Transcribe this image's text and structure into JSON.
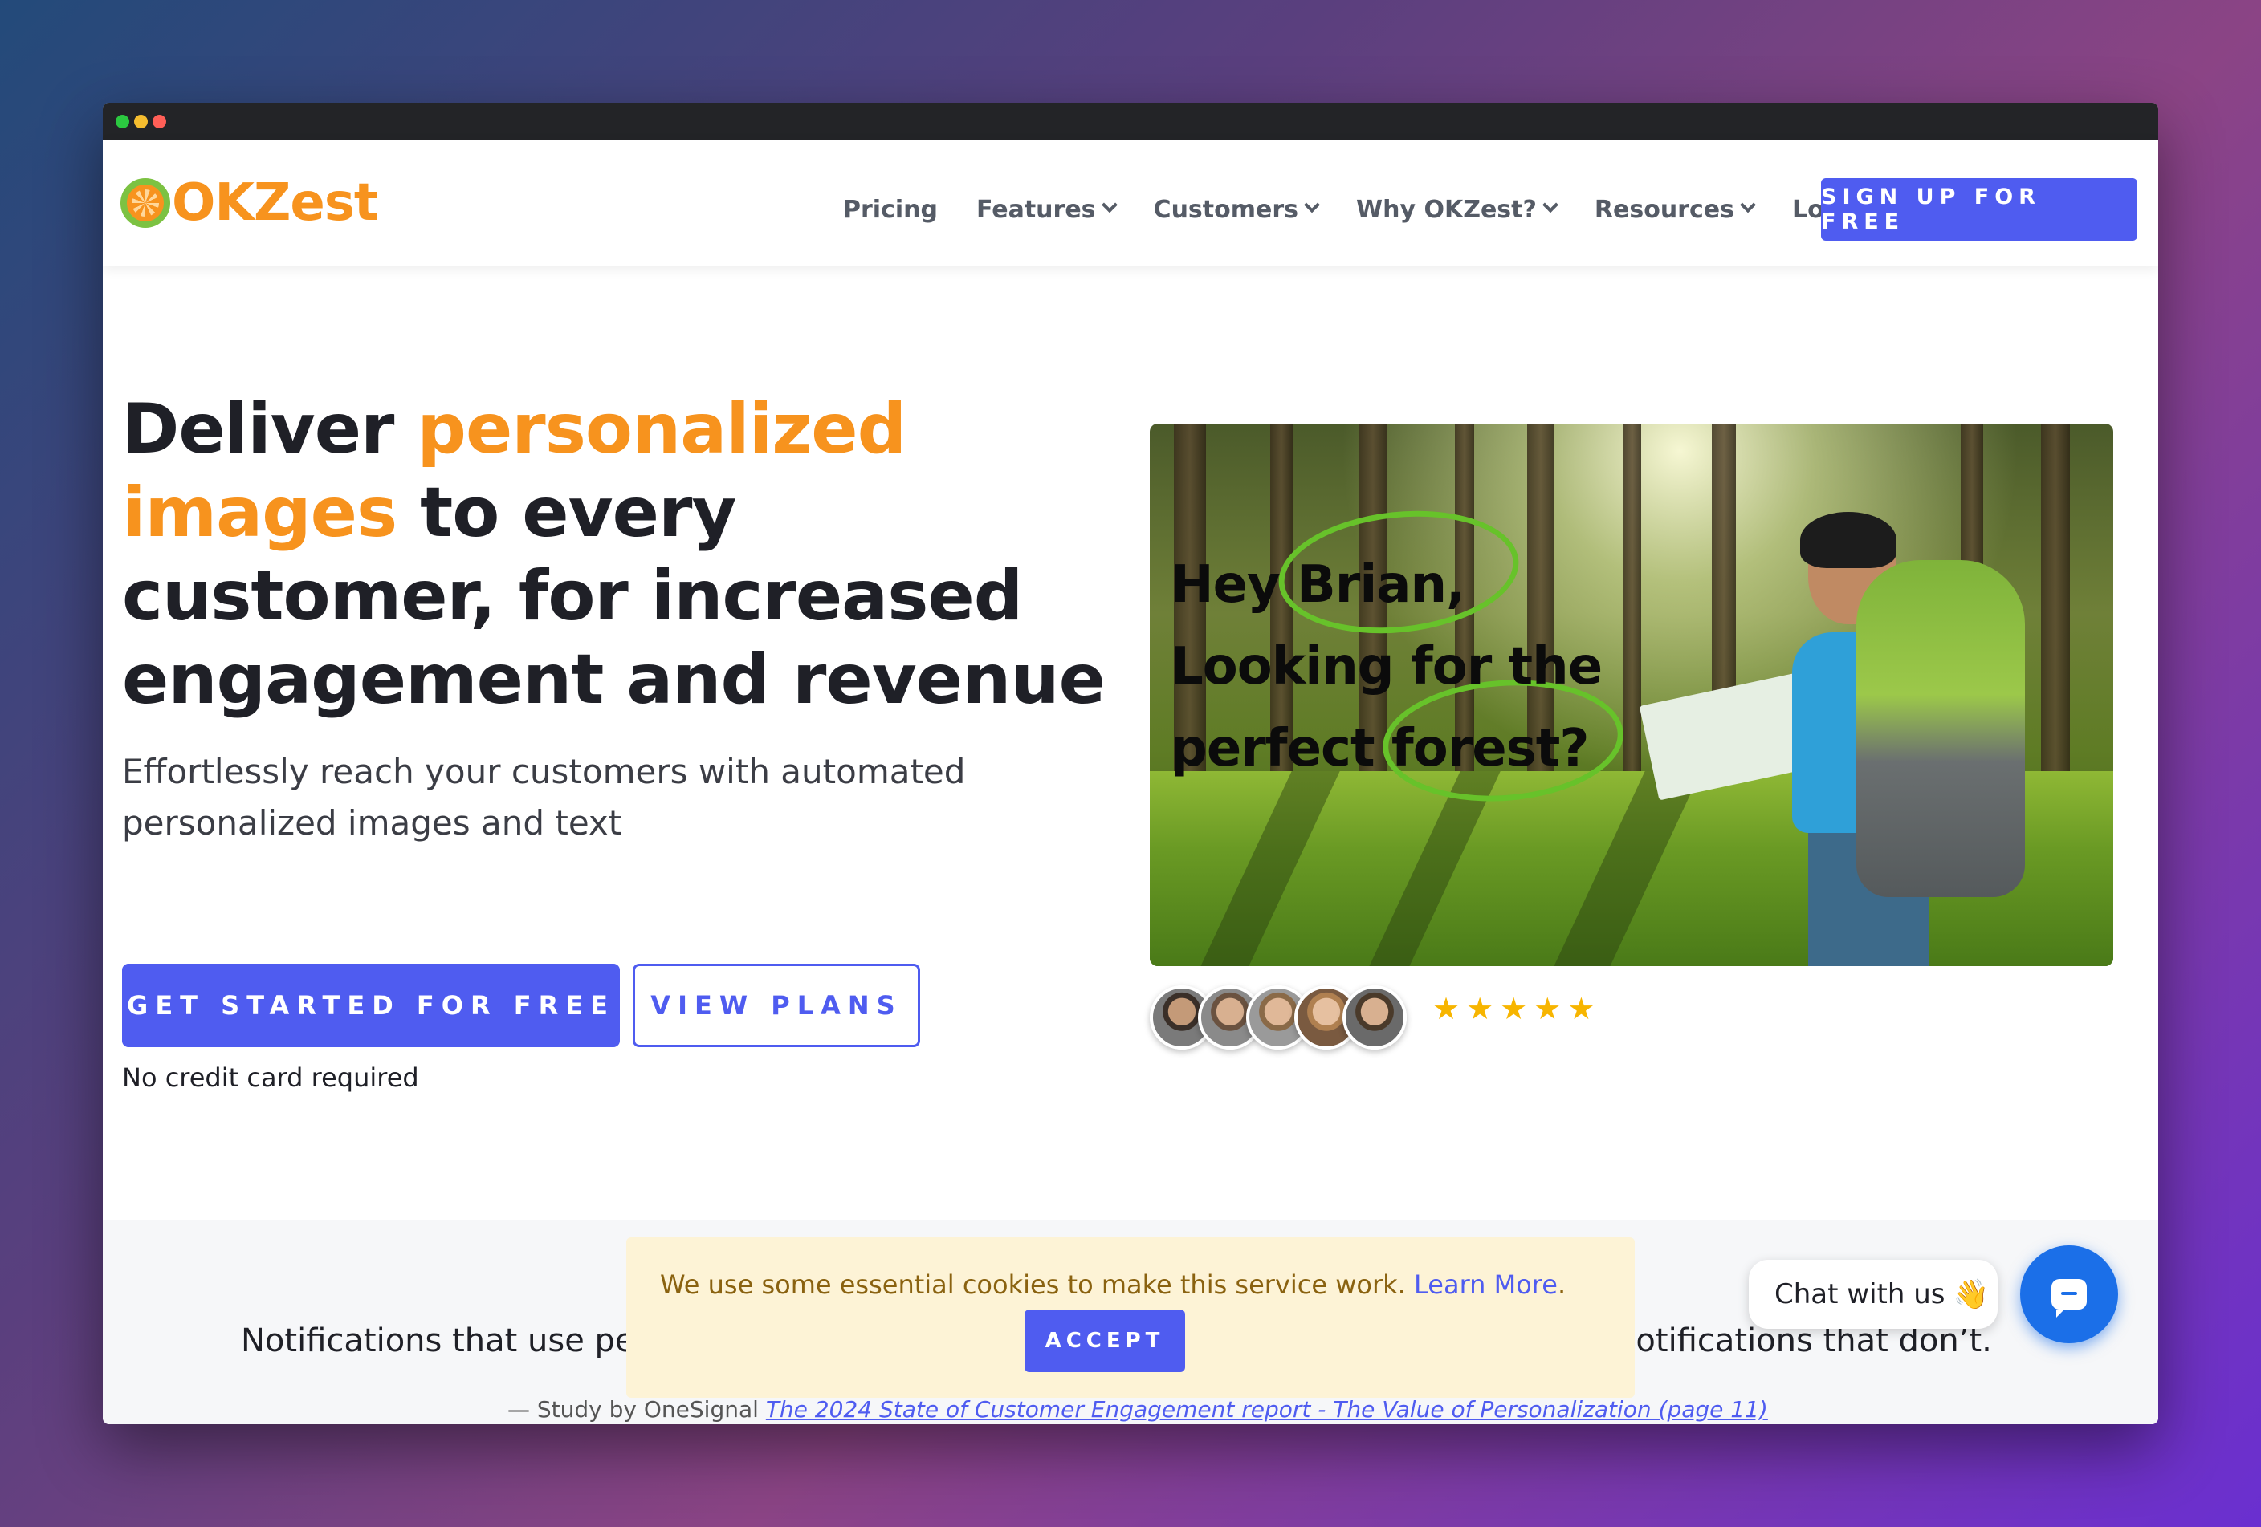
{
  "brand": {
    "name": "OKZest",
    "logo_icon": "orange-slice-icon",
    "accent": "#f7931e",
    "primary": "#4f5cf0"
  },
  "nav": {
    "items": [
      {
        "label": "Pricing",
        "dropdown": false
      },
      {
        "label": "Features",
        "dropdown": true
      },
      {
        "label": "Customers",
        "dropdown": true
      },
      {
        "label": "Why OKZest?",
        "dropdown": true
      },
      {
        "label": "Resources",
        "dropdown": true
      },
      {
        "label": "Login",
        "dropdown": false
      }
    ],
    "signup_label": "SIGN UP FOR FREE"
  },
  "hero": {
    "title_pre": "Deliver ",
    "title_accent": "personalized images",
    "title_post": " to every customer, for increased engagement and revenue",
    "subtitle": "Effortlessly reach your customers with automated personalized images and text",
    "cta_primary": "GET STARTED FOR FREE",
    "cta_secondary": "VIEW PLANS",
    "note": "No credit card required",
    "image_line1_a": "Hey ",
    "image_line1_b": "Brian,",
    "image_line2": "Looking for the",
    "image_line3_a": "perfect ",
    "image_line3_b": "forest?",
    "rating_stars": 5
  },
  "stats": {
    "left_text": "Notifications that use pe",
    "right_text": "n notifications that don’t.",
    "study_prefix": "— Study by OneSignal ",
    "study_link": "The 2024 State of Customer Engagement report - The Value of Personalization (page 11)"
  },
  "cookie": {
    "text": "We use some essential cookies to make this service work. ",
    "link": "Learn More",
    "suffix": ".",
    "accept_label": "ACCEPT"
  },
  "chat": {
    "pill_label": "Chat with us",
    "wave_icon": "👋"
  }
}
